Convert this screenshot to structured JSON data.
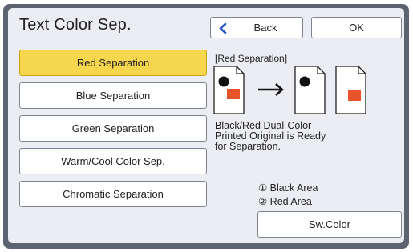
{
  "header": {
    "title": "Text Color Sep.",
    "back_label": "Back",
    "ok_label": "OK"
  },
  "options": [
    {
      "label": "Red Separation",
      "selected": true
    },
    {
      "label": "Blue Separation",
      "selected": false
    },
    {
      "label": "Green Separation",
      "selected": false
    },
    {
      "label": "Warm/Cool Color Sep.",
      "selected": false
    },
    {
      "label": "Chromatic Separation",
      "selected": false
    }
  ],
  "preview": {
    "label": "[Red Separation]",
    "description": "Black/Red Dual-Color\nPrinted Original is Ready\nfor Separation.",
    "legend": [
      "① Black Area",
      "② Red Area"
    ]
  },
  "switch_button_label": "Sw.Color",
  "colors": {
    "selected": "#f6d64c",
    "accent_red": "#e8542a",
    "back_chevron": "#2456c8",
    "frame": "#5b6470"
  }
}
